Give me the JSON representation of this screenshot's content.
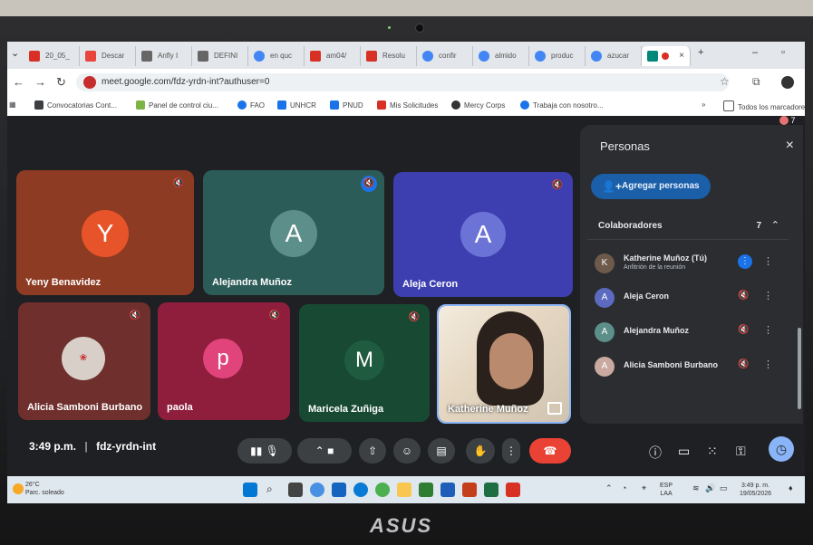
{
  "tabs": [
    {
      "label": "20_05_",
      "color": "#d93025"
    },
    {
      "label": "Descar",
      "color": "#e8453c"
    },
    {
      "label": "Anfly I",
      "color": "#555555"
    },
    {
      "label": "DEFINI",
      "color": "#555555"
    },
    {
      "label": "en quc",
      "color": "#4285f4"
    },
    {
      "label": "am04/",
      "color": "#d93025"
    },
    {
      "label": "Resolu",
      "color": "#d93025"
    },
    {
      "label": "confir",
      "color": "#4285f4"
    },
    {
      "label": "almido",
      "color": "#4285f4"
    },
    {
      "label": "produc",
      "color": "#4285f4"
    },
    {
      "label": "azucar",
      "color": "#4285f4"
    }
  ],
  "active_tab": {
    "close": "×"
  },
  "new_tab": "+",
  "window": {
    "minimize": "–",
    "restore": "▫"
  },
  "address": {
    "url": "meet.google.com/fdz-yrdn-int?authuser=0"
  },
  "bookmarks": [
    {
      "label": "Convocatorias Cont...",
      "color": "#3c4043"
    },
    {
      "label": "Panel de control ciu...",
      "color": "#7cb342"
    },
    {
      "label": "FAO",
      "color": "#1a73e8"
    },
    {
      "label": "UNHCR",
      "color": "#1a73e8"
    },
    {
      "label": "PNUD",
      "color": "#1a73e8"
    },
    {
      "label": "Mis Solicitudes",
      "color": "#d93025"
    },
    {
      "label": "Mercy Corps",
      "color": "#333333"
    },
    {
      "label": "Trabaja con nosotro...",
      "color": "#1a73e8"
    }
  ],
  "bookmarks_more": "»",
  "all_bookmarks": "Todos los marcadores",
  "participant_count_badge": "7",
  "tiles": [
    {
      "name": "Yeny Benavidez",
      "initial": "Y",
      "avatar_color": "#e8542a",
      "bg": "#8d3b23"
    },
    {
      "name": "Alejandra Muñoz",
      "initial": "A",
      "avatar_color": "#5d8f8a",
      "bg": "#2c5c58"
    },
    {
      "name": "Aleja Ceron",
      "initial": "A",
      "avatar_color": "#6b73d6",
      "bg": "#3d3fb0"
    },
    {
      "name": "Alicia Samboni Burbano",
      "initial": "",
      "avatar_color": "#d8d0c8",
      "bg": "#6e2f2d"
    },
    {
      "name": "paola",
      "initial": "p",
      "avatar_color": "#e0447a",
      "bg": "#8f1e3d"
    },
    {
      "name": "Maricela Zuñiga",
      "initial": "M",
      "avatar_color": "#1f5b3f",
      "bg": "#184a33"
    },
    {
      "name": "Katherine Muñoz",
      "initial": "",
      "avatar_color": "#7b6a5e",
      "bg": "#cfc9bf"
    }
  ],
  "meeting": {
    "time": "3:49 p.m.",
    "separator": "|",
    "code": "fdz-yrdn-int"
  },
  "panel": {
    "title": "Personas",
    "close": "×",
    "add_people": "Agregar personas",
    "section": "Colaboradores",
    "count": "7",
    "chevron": "⌃",
    "people": [
      {
        "name": "Katherine Muñoz (Tú)",
        "role": "Anfitrión de la reunión",
        "avatar_color": "#6d5a4b",
        "initial": "K"
      },
      {
        "name": "Aleja Ceron",
        "role": "",
        "avatar_color": "#5c6bc0",
        "initial": "A"
      },
      {
        "name": "Alejandra Muñoz",
        "role": "",
        "avatar_color": "#5d8f8a",
        "initial": "A"
      },
      {
        "name": "Alicia Samboni Burbano",
        "role": "",
        "avatar_color": "#c9a9a0",
        "initial": "A"
      }
    ]
  },
  "taskbar": {
    "temp": "26°C",
    "weather": "Parc. soleado",
    "lang_top": "ESP",
    "lang_bottom": "LAA",
    "time": "3:49 p. m.",
    "date": "19/05/2026"
  },
  "brand": "ASUS"
}
